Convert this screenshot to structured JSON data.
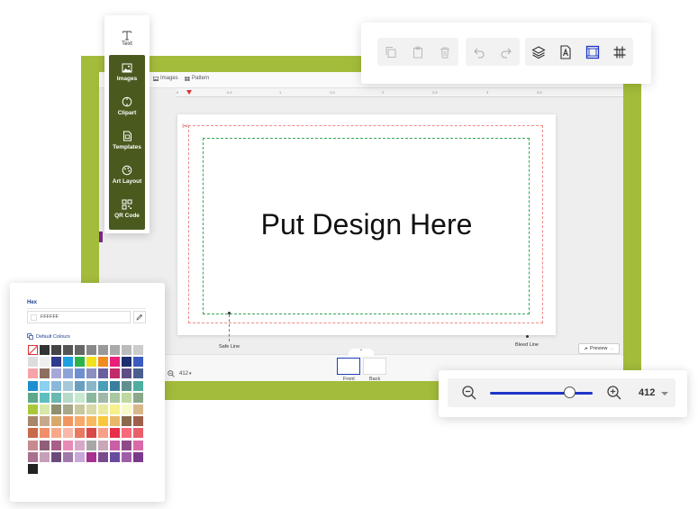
{
  "editor": {
    "tabs": [
      {
        "label": "Images"
      },
      {
        "label": "Pattern"
      }
    ],
    "ruler_ticks": [
      "0",
      "0.5",
      "1",
      "1.5",
      "2",
      "2.5",
      "3",
      "3.5"
    ],
    "canvas_text": "Put Design Here",
    "safe_line_label": "Safe Line",
    "bleed_line_label": "Bleed Line",
    "preview_label": "Preview",
    "sides": [
      {
        "label": "Front",
        "active": true
      },
      {
        "label": "Back",
        "active": false
      }
    ],
    "mini_zoom_value": "412"
  },
  "side_toolbar": {
    "items": [
      {
        "label": "Text",
        "icon": "text-icon"
      },
      {
        "label": "Images",
        "icon": "image-icon"
      },
      {
        "label": "Clipart",
        "icon": "clipart-icon"
      },
      {
        "label": "Templates",
        "icon": "templates-icon"
      },
      {
        "label": "Art Layout",
        "icon": "art-layout-icon"
      },
      {
        "label": "QR Code",
        "icon": "qr-code-icon"
      }
    ]
  },
  "top_toolbar": {
    "groups": [
      [
        "copy-icon",
        "paste-icon",
        "delete-icon"
      ],
      [
        "undo-icon",
        "redo-icon"
      ],
      [
        "layers-icon",
        "font-file-icon",
        "frame-icon",
        "grid-icon"
      ]
    ]
  },
  "color_panel": {
    "hex_label": "Hex",
    "hex_value": "FFFFFF",
    "default_colours_label": "Default Colours",
    "swatches": [
      "none",
      "#333333",
      "#444444",
      "#555555",
      "#666666",
      "#888888",
      "#999999",
      "#aaaaaa",
      "#bbbbbb",
      "#cccccc",
      "#dddddd",
      "#eeeeee",
      "#2e3a8c",
      "#1e9fe0",
      "#2bb24c",
      "#f2e21a",
      "#f08c1e",
      "#e8207a",
      "#1d2f6f",
      "#3a5bbf",
      "#f5a3a8",
      "#8c6f5e",
      "#a6a8d8",
      "#8da3d6",
      "#6e8fd0",
      "#8a8fbf",
      "#6a5f9f",
      "#c22a6a",
      "#5d4f86",
      "#4a5f8f",
      "#1e8fd0",
      "#8ad0ef",
      "#8ab8d8",
      "#a6c8d8",
      "#6a9fbf",
      "#8ab6c8",
      "#4a9fb8",
      "#3a7f9f",
      "#5f8f8f",
      "#4fae9f",
      "#5fa88a",
      "#5fbfbf",
      "#6ab8b0",
      "#b8d8c8",
      "#c8e8d0",
      "#8ab89f",
      "#9fb8a8",
      "#a8c89f",
      "#bfd89f",
      "#8aa88a",
      "#a8c83a",
      "#d8e8a8",
      "#8f8f6f",
      "#a8a88a",
      "#c8c89f",
      "#d8d8a8",
      "#e8e89f",
      "#f8f08a",
      "#f8f8c8",
      "#d8b88a",
      "#a8866a",
      "#c8a88a",
      "#d8a86a",
      "#f0955f",
      "#f8a86a",
      "#f8b85f",
      "#f8c83a",
      "#e8b86a",
      "#8a6a4a",
      "#9f5f4a",
      "#c86a4a",
      "#f08f6a",
      "#f8a88a",
      "#f8b8a8",
      "#e87a5f",
      "#d84a4a",
      "#f89f8a",
      "#e8304a",
      "#f86a7a",
      "#e85f6a",
      "#c88a8f",
      "#8f5f7a",
      "#a85f8a",
      "#e88ab8",
      "#d8a8c8",
      "#a8a8a8",
      "#c8a8b8",
      "#c85fa8",
      "#8f4a8a",
      "#d86aa8",
      "#a8708f",
      "#c89fb8",
      "#6a4a7a",
      "#9f7aa8",
      "#c8a8d8",
      "#a8308f",
      "#7a4a8f",
      "#6a4a9f",
      "#9f5fa8",
      "#7a3a8a",
      "#222222"
    ]
  },
  "zoom_panel": {
    "value": "412",
    "level": 0.78
  },
  "colors": {
    "frame_green": "#a3bc3b",
    "toolbar_dark_green": "#4a5a1f",
    "accent_blue": "#1f35c8",
    "bleed_line": "#f08a8a",
    "safe_line": "#3aa357"
  }
}
